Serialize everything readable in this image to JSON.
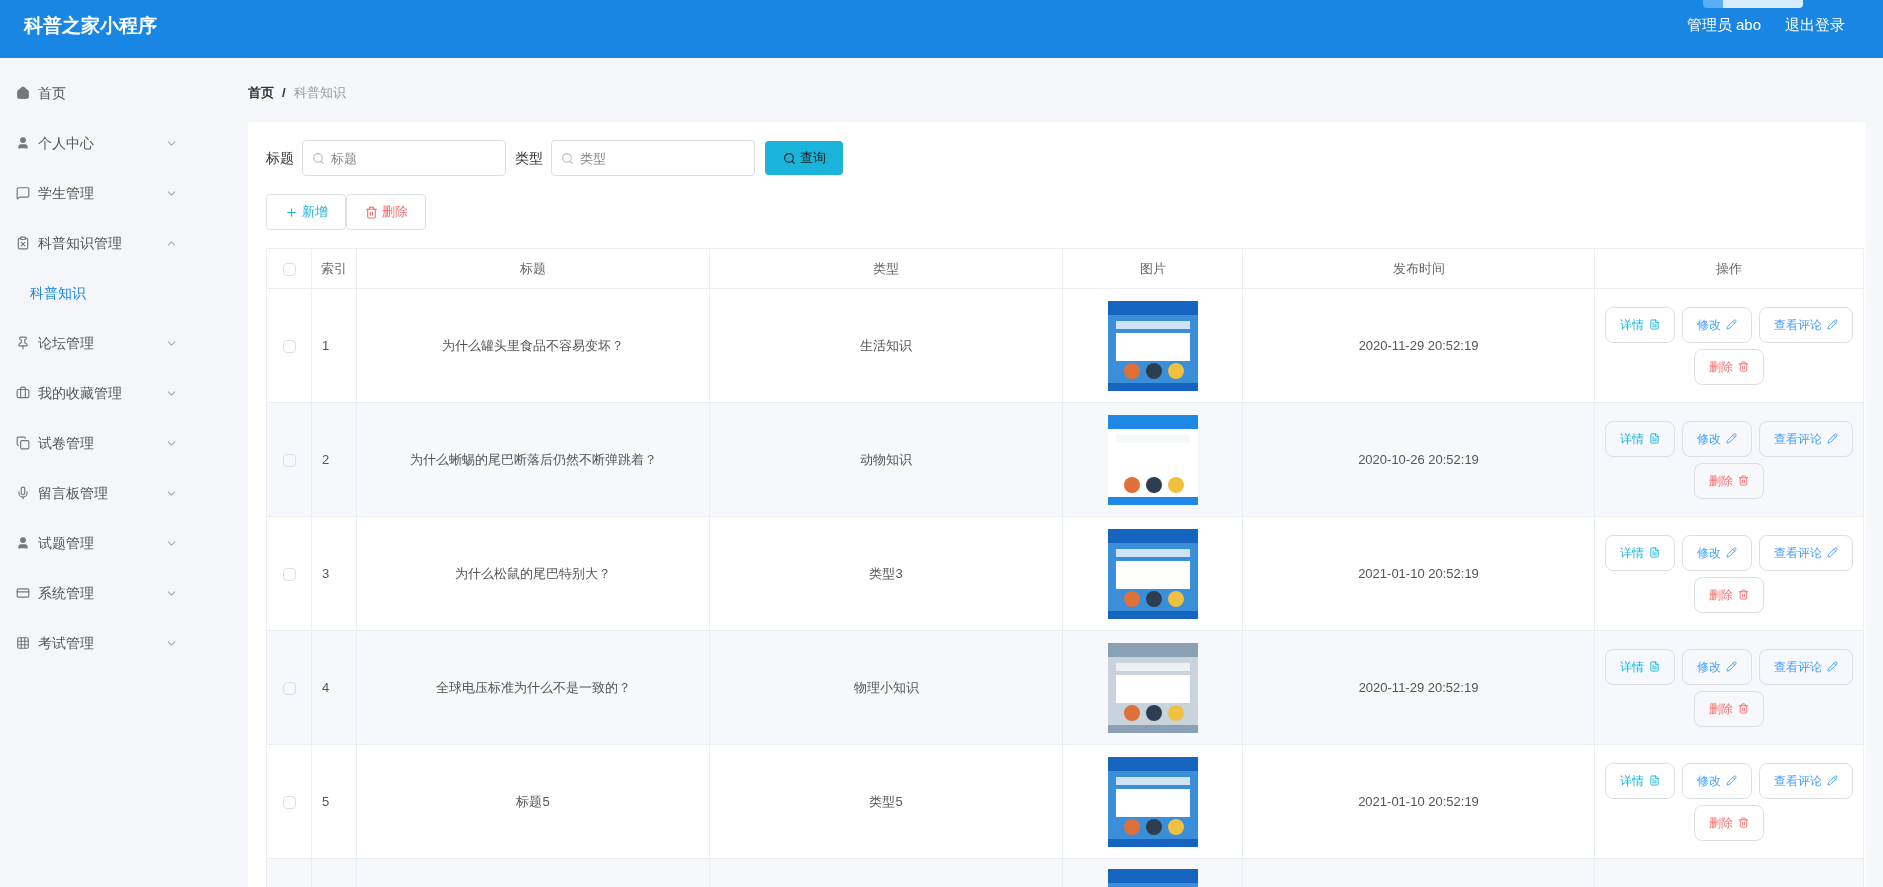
{
  "header": {
    "title": "科普之家小程序",
    "user": "管理员 abo",
    "logout": "退出登录"
  },
  "sidebar": {
    "items": [
      {
        "label": "首页"
      },
      {
        "label": "个人中心",
        "expanded": false
      },
      {
        "label": "学生管理",
        "expanded": false
      },
      {
        "label": "科普知识管理",
        "expanded": true,
        "children": [
          {
            "label": "科普知识",
            "selected": true
          }
        ]
      },
      {
        "label": "论坛管理",
        "expanded": false
      },
      {
        "label": "我的收藏管理",
        "expanded": false
      },
      {
        "label": "试卷管理",
        "expanded": false
      },
      {
        "label": "留言板管理",
        "expanded": false
      },
      {
        "label": "试题管理",
        "expanded": false
      },
      {
        "label": "系统管理",
        "expanded": false
      },
      {
        "label": "考试管理",
        "expanded": false
      }
    ]
  },
  "breadcrumb": [
    "首页",
    "/",
    "科普知识"
  ],
  "search": {
    "fields": [
      {
        "label": "标题",
        "placeholder": "标题"
      },
      {
        "label": "类型",
        "placeholder": "类型"
      }
    ],
    "button": "查询"
  },
  "actions": [
    {
      "kind": "add",
      "label": "新增"
    },
    {
      "kind": "delete",
      "label": "删除"
    }
  ],
  "table": {
    "select_all": {
      "checked": false
    },
    "columns": [
      "索引",
      "标题",
      "类型",
      "图片",
      "发布时间",
      "操作"
    ],
    "rows": [
      {
        "index": "1",
        "title": "为什么罐头里食品不容易变坏？",
        "type": "生活知识",
        "time": "2020-11-29 20:52:19",
        "checked": false,
        "buttons": [
          {
            "kind": "detail",
            "label": "详情"
          },
          {
            "kind": "edit",
            "label": "修改"
          },
          {
            "kind": "comments",
            "label": "查看评论"
          },
          {
            "kind": "delete",
            "label": "删除"
          }
        ]
      },
      {
        "index": "2",
        "title": "为什么蜥蜴的尾巴断落后仍然不断弹跳着？",
        "type": "动物知识",
        "time": "2020-10-26 20:52:19",
        "checked": false,
        "buttons": [
          {
            "kind": "detail",
            "label": "详情"
          },
          {
            "kind": "edit",
            "label": "修改"
          },
          {
            "kind": "comments",
            "label": "查看评论"
          },
          {
            "kind": "delete",
            "label": "删除"
          }
        ]
      },
      {
        "index": "3",
        "title": "为什么松鼠的尾巴特别大？",
        "type": "类型3",
        "time": "2021-01-10 20:52:19",
        "checked": false,
        "buttons": [
          {
            "kind": "detail",
            "label": "详情"
          },
          {
            "kind": "edit",
            "label": "修改"
          },
          {
            "kind": "comments",
            "label": "查看评论"
          },
          {
            "kind": "delete",
            "label": "删除"
          }
        ]
      },
      {
        "index": "4",
        "title": "全球电压标准为什么不是一致的？",
        "type": "物理小知识",
        "time": "2020-11-29 20:52:19",
        "checked": false,
        "buttons": [
          {
            "kind": "detail",
            "label": "详情"
          },
          {
            "kind": "edit",
            "label": "修改"
          },
          {
            "kind": "comments",
            "label": "查看评论"
          },
          {
            "kind": "delete",
            "label": "删除"
          }
        ]
      },
      {
        "index": "5",
        "title": "标题5",
        "type": "类型5",
        "time": "2021-01-10 20:52:19",
        "checked": false,
        "buttons": [
          {
            "kind": "detail",
            "label": "详情"
          },
          {
            "kind": "edit",
            "label": "修改"
          },
          {
            "kind": "comments",
            "label": "查看评论"
          },
          {
            "kind": "delete",
            "label": "删除"
          }
        ]
      }
    ]
  }
}
